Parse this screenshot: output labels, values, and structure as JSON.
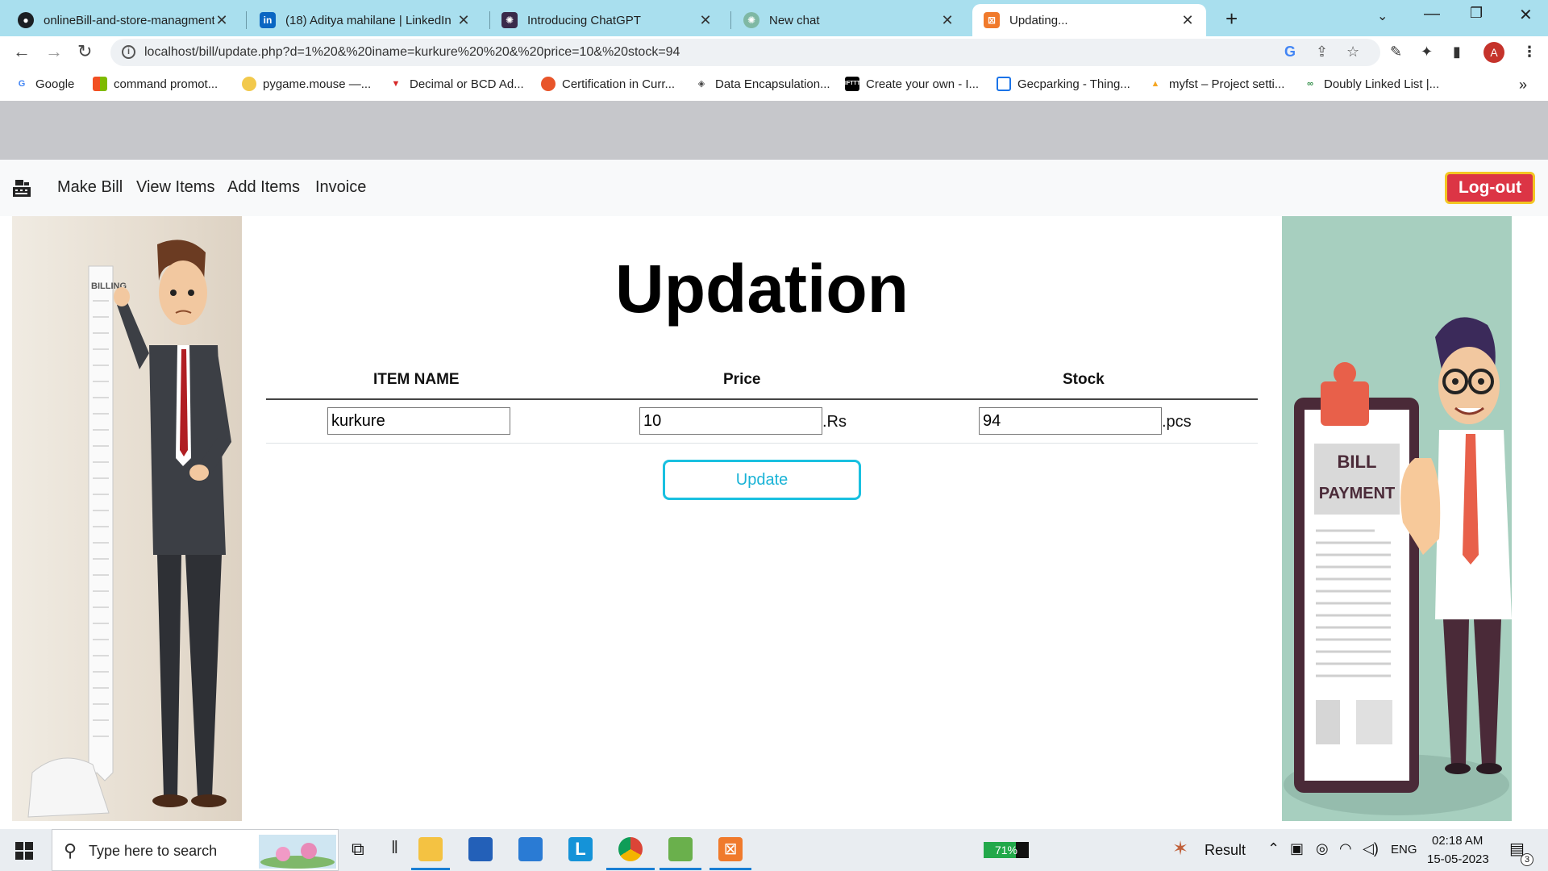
{
  "browser": {
    "tabs": [
      {
        "title": "onlineBill-and-store-managment",
        "icon": "github-icon",
        "active": false
      },
      {
        "title": "(18) Aditya mahilane | LinkedIn",
        "icon": "linkedin-icon",
        "active": false
      },
      {
        "title": "Introducing ChatGPT",
        "icon": "openai-icon",
        "active": false
      },
      {
        "title": "New chat",
        "icon": "chatgpt-icon",
        "active": false
      },
      {
        "title": "Updating...",
        "icon": "xampp-icon",
        "active": true
      }
    ],
    "url": "localhost/bill/update.php?d=1%20&%20iname=kurkure%20%20&%20price=10&%20stock=94",
    "avatar_letter": "A",
    "bookmarks": [
      "Google",
      "command promot...",
      "pygame.mouse —...",
      "Decimal or BCD Ad...",
      "Certification in Curr...",
      "Data Encapsulation...",
      "Create your own - I...",
      "Gecparking - Thing...",
      "myfst – Project setti...",
      "Doubly Linked List |..."
    ]
  },
  "navbar": {
    "links": [
      "Make Bill",
      "View Items",
      "Add Items",
      "Invoice"
    ],
    "logout_label": "Log-out"
  },
  "page": {
    "title": "Updation",
    "headers": {
      "item": "ITEM NAME",
      "price": "Price",
      "stock": "Stock"
    },
    "item_value": "kurkure",
    "price_value": "10",
    "price_unit": ".Rs",
    "stock_value": "94",
    "stock_unit": ".pcs",
    "update_label": "Update",
    "left_art_text": "BILLING",
    "right_art_text_1": "BILL",
    "right_art_text_2": "PAYMENT"
  },
  "taskbar": {
    "search_placeholder": "Type here to search",
    "battery_pct": "71%",
    "battery_level": 0.71,
    "weather_label": "Result",
    "lang": "ENG",
    "time": "02:18 AM",
    "date": "15-05-2023",
    "notif_count": "3"
  },
  "colors": {
    "tabbar": "#a9dfee",
    "logout": "#dc3545",
    "logout_border": "#f3c623",
    "update_btn": "#19c0e0"
  }
}
